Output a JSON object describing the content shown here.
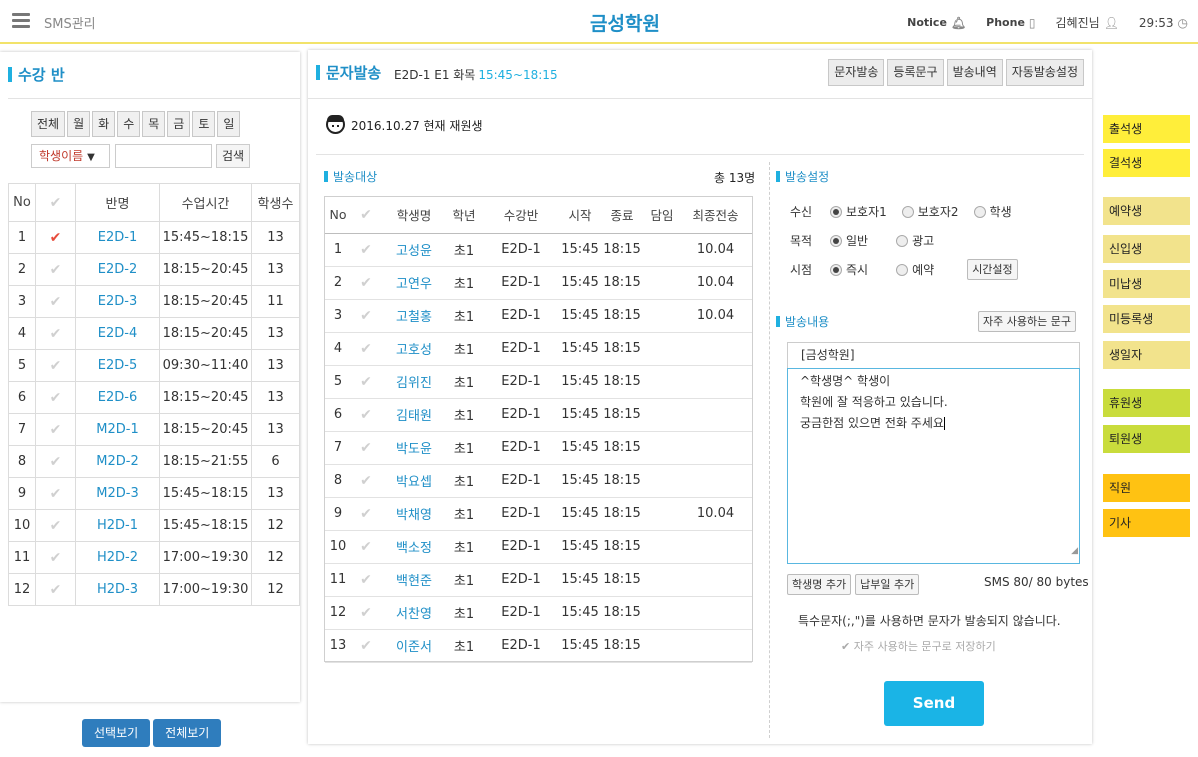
{
  "header": {
    "app_name": "SMS관리",
    "academy": "금성학원",
    "notice": "Notice",
    "phone": "Phone",
    "user": "김혜진님",
    "time": "29:53"
  },
  "left": {
    "title": "수강 반",
    "days": [
      "전체",
      "월",
      "화",
      "수",
      "목",
      "금",
      "토",
      "일"
    ],
    "search_select": "학생이름",
    "search_button": "검색",
    "columns": [
      "No",
      "",
      "반명",
      "수업시간",
      "학생수"
    ],
    "rows": [
      {
        "no": "1",
        "code": "E2D-1",
        "time": "15:45~18:15",
        "count": "13",
        "checked": true
      },
      {
        "no": "2",
        "code": "E2D-2",
        "time": "18:15~20:45",
        "count": "13",
        "checked": false
      },
      {
        "no": "3",
        "code": "E2D-3",
        "time": "18:15~20:45",
        "count": "11",
        "checked": false
      },
      {
        "no": "4",
        "code": "E2D-4",
        "time": "18:15~20:45",
        "count": "13",
        "checked": false
      },
      {
        "no": "5",
        "code": "E2D-5",
        "time": "09:30~11:40",
        "count": "13",
        "checked": false
      },
      {
        "no": "6",
        "code": "E2D-6",
        "time": "18:15~20:45",
        "count": "13",
        "checked": false
      },
      {
        "no": "7",
        "code": "M2D-1",
        "time": "18:15~20:45",
        "count": "13",
        "checked": false
      },
      {
        "no": "8",
        "code": "M2D-2",
        "time": "18:15~21:55",
        "count": "6",
        "checked": false
      },
      {
        "no": "9",
        "code": "M2D-3",
        "time": "15:45~18:15",
        "count": "13",
        "checked": false
      },
      {
        "no": "10",
        "code": "H2D-1",
        "time": "15:45~18:15",
        "count": "12",
        "checked": false
      },
      {
        "no": "11",
        "code": "H2D-2",
        "time": "17:00~19:30",
        "count": "12",
        "checked": false
      },
      {
        "no": "12",
        "code": "H2D-3",
        "time": "17:00~19:30",
        "count": "12",
        "checked": false
      }
    ],
    "btn_select_view": "선택보기",
    "btn_all_view": "전체보기"
  },
  "main": {
    "title": "문자발송",
    "class_info": "E2D-1 E1 화목",
    "class_time": "15:45~18:15",
    "tabs": [
      "문자발송",
      "등록문구",
      "발송내역",
      "자동발송설정"
    ],
    "today": "2016.10.27 현재 재원생",
    "targets_title": "발송대상",
    "total": "총 13명",
    "columns": [
      "No",
      "",
      "학생명",
      "학년",
      "수강반",
      "시작",
      "종료",
      "담임",
      "최종전송"
    ],
    "students": [
      {
        "no": "1",
        "name": "고성윤",
        "grade": "초1",
        "cls": "E2D-1",
        "start": "15:45",
        "end": "18:15",
        "teacher": "",
        "last": "10.04"
      },
      {
        "no": "2",
        "name": "고연우",
        "grade": "초1",
        "cls": "E2D-1",
        "start": "15:45",
        "end": "18:15",
        "teacher": "",
        "last": "10.04"
      },
      {
        "no": "3",
        "name": "고철홍",
        "grade": "초1",
        "cls": "E2D-1",
        "start": "15:45",
        "end": "18:15",
        "teacher": "",
        "last": "10.04"
      },
      {
        "no": "4",
        "name": "고호성",
        "grade": "초1",
        "cls": "E2D-1",
        "start": "15:45",
        "end": "18:15",
        "teacher": "",
        "last": ""
      },
      {
        "no": "5",
        "name": "김위진",
        "grade": "초1",
        "cls": "E2D-1",
        "start": "15:45",
        "end": "18:15",
        "teacher": "",
        "last": ""
      },
      {
        "no": "6",
        "name": "김태원",
        "grade": "초1",
        "cls": "E2D-1",
        "start": "15:45",
        "end": "18:15",
        "teacher": "",
        "last": ""
      },
      {
        "no": "7",
        "name": "박도윤",
        "grade": "초1",
        "cls": "E2D-1",
        "start": "15:45",
        "end": "18:15",
        "teacher": "",
        "last": ""
      },
      {
        "no": "8",
        "name": "박요셉",
        "grade": "초1",
        "cls": "E2D-1",
        "start": "15:45",
        "end": "18:15",
        "teacher": "",
        "last": ""
      },
      {
        "no": "9",
        "name": "박채영",
        "grade": "초1",
        "cls": "E2D-1",
        "start": "15:45",
        "end": "18:15",
        "teacher": "",
        "last": "10.04"
      },
      {
        "no": "10",
        "name": "백소정",
        "grade": "초1",
        "cls": "E2D-1",
        "start": "15:45",
        "end": "18:15",
        "teacher": "",
        "last": ""
      },
      {
        "no": "11",
        "name": "백현준",
        "grade": "초1",
        "cls": "E2D-1",
        "start": "15:45",
        "end": "18:15",
        "teacher": "",
        "last": ""
      },
      {
        "no": "12",
        "name": "서찬영",
        "grade": "초1",
        "cls": "E2D-1",
        "start": "15:45",
        "end": "18:15",
        "teacher": "",
        "last": ""
      },
      {
        "no": "13",
        "name": "이준서",
        "grade": "초1",
        "cls": "E2D-1",
        "start": "15:45",
        "end": "18:15",
        "teacher": "",
        "last": ""
      }
    ],
    "settings_title": "발송설정",
    "recipient_label": "수신",
    "recipient_options": [
      "보호자1",
      "보호자2",
      "학생"
    ],
    "purpose_label": "목적",
    "purpose_options": [
      "일반",
      "광고"
    ],
    "timing_label": "시점",
    "timing_options": [
      "즉시",
      "예약"
    ],
    "time_setting_button": "시간설정",
    "content_title": "발송내용",
    "frequent_phrase_button": "자주 사용하는 문구",
    "sender_tag": "[금성학원]",
    "message_lines": [
      "^학생명^ 학생이",
      "학원에 잘 적응하고 있습니다.",
      "궁금한점 있으면 전화 주세요"
    ],
    "add_name_button": "학생명 추가",
    "add_due_button": "납부일 추가",
    "bytes": "SMS 80/ 80 bytes",
    "warning": "특수문자(;,\")를 사용하면 문자가 발송되지 않습니다.",
    "save_frequent": "자주 사용하는 문구로 저장하기",
    "send": "Send"
  },
  "categories": [
    {
      "label": "출석생",
      "color": "#ffee3a"
    },
    {
      "label": "결석생",
      "color": "#ffee3a"
    },
    {
      "label": "예약생",
      "color": "#f2e38c"
    },
    {
      "label": "신입생",
      "color": "#f2e38c"
    },
    {
      "label": "미납생",
      "color": "#f2e38c"
    },
    {
      "label": "미등록생",
      "color": "#f2e38c"
    },
    {
      "label": "생일자",
      "color": "#f2e38c"
    },
    {
      "label": "휴원생",
      "color": "#c9dc3c"
    },
    {
      "label": "퇴원생",
      "color": "#c9dc3c"
    },
    {
      "label": "직원",
      "color": "#ffc212"
    },
    {
      "label": "기사",
      "color": "#ffc212"
    }
  ]
}
